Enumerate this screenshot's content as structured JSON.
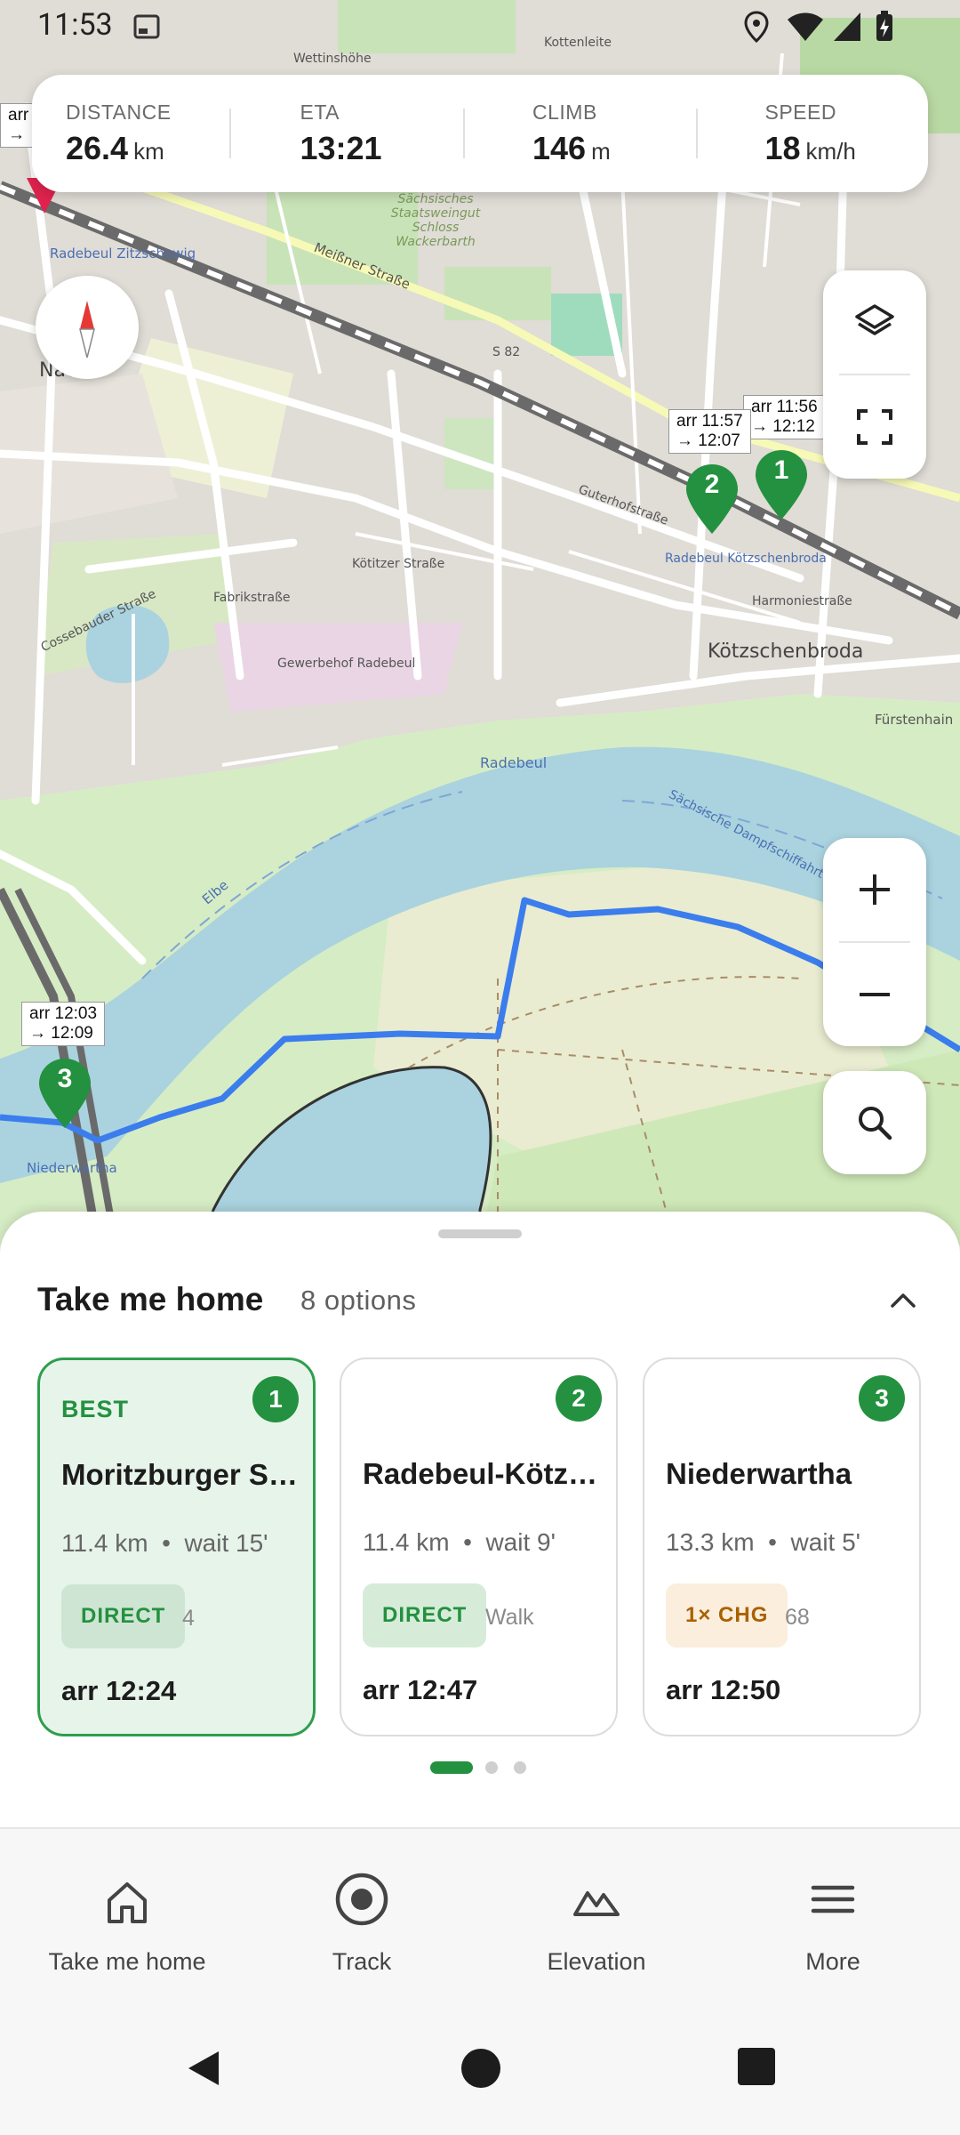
{
  "status_bar": {
    "time": "11:53"
  },
  "stats": [
    {
      "label": "DISTANCE",
      "value": "26.4",
      "unit": "km"
    },
    {
      "label": "ETA",
      "value": "13:21",
      "unit": ""
    },
    {
      "label": "CLIMB",
      "value": "146",
      "unit": "m"
    },
    {
      "label": "SPEED",
      "value": "18",
      "unit": "km/h"
    }
  ],
  "map": {
    "labels": {
      "radebeul_zitzschewig": "Radebeul Zitzschewig",
      "meissner_strasse": "Meißner Straße",
      "weingut": "Sächsisches Staatsweingut Schloss Wackerbarth",
      "s82": "S 82",
      "koetitzer_strasse": "Kötitzer Straße",
      "cossebauder_strasse": "Cossebauder Straße",
      "gewerbehof": "Gewerbehof Radebeul",
      "koetzschenbroda": "Kötzschenbroda",
      "radebeul_koetzschenbroda": "Radebeul Kötzschenbroda",
      "radebeul": "Radebeul",
      "elbe": "Elbe",
      "dampfschiff": "Sächsische Dampfschiffahrt",
      "niederwartha": "Niederwartha",
      "fuerstenhain": "Fürstenhain",
      "guterhofstrasse": "Guterhofstraße",
      "harmoniestrasse": "Harmoniestraße",
      "fabrikstrasse": "Fabrikstraße",
      "nachbar": "Nac",
      "kottenleite": "Kottenleite",
      "wettinshohe": "Wettinshöhe"
    },
    "stations": [
      {
        "num": "1",
        "tip_arr": "arr 11:56",
        "tip_dep": "→ 12:12"
      },
      {
        "num": "2",
        "tip_arr": "arr 11:57",
        "tip_dep": "→ 12:07"
      },
      {
        "num": "3",
        "tip_arr": "arr 12:03",
        "tip_dep": "→ 12:09"
      }
    ],
    "edge_tip_arr": "arr",
    "edge_tip_dep": "→"
  },
  "sheet": {
    "title": "Take me home",
    "count": "8 options",
    "cards": [
      {
        "best": "BEST",
        "badge": "1",
        "name": "Moritzburger Straße",
        "distance": "11.4 km",
        "wait": "wait 15'",
        "tag": "DIRECT",
        "sub": "4",
        "arr": "arr 12:24"
      },
      {
        "best": "",
        "badge": "2",
        "name": "Radebeul-Kötzschenbroda",
        "distance": "11.4 km",
        "wait": "wait 9'",
        "tag": "DIRECT",
        "sub": "Walk",
        "arr": "arr 12:47"
      },
      {
        "best": "",
        "badge": "3",
        "name": "Niederwartha",
        "distance": "13.3 km",
        "wait": "wait 5'",
        "tag": "1× CHG",
        "sub": "68",
        "arr": "arr 12:50"
      }
    ],
    "page_indicator": {
      "active": 1,
      "total": 3
    }
  },
  "nav": [
    {
      "label": "Take me home",
      "icon": "home-icon"
    },
    {
      "label": "Track",
      "icon": "track-icon"
    },
    {
      "label": "Elevation",
      "icon": "elevation-icon"
    },
    {
      "label": "More",
      "icon": "menu-icon"
    }
  ],
  "colors": {
    "route": "#3b7ded",
    "accent_green": "#23913f",
    "water": "#aad3df",
    "rail": "#555555"
  }
}
